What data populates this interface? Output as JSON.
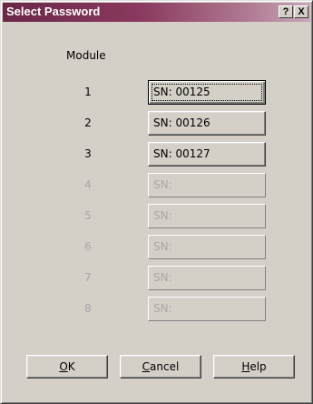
{
  "window": {
    "title": "Select Password",
    "help_glyph": "?",
    "close_glyph": "X"
  },
  "column_header": "Module",
  "modules": [
    {
      "number": "1",
      "serial": "SN: 00125",
      "enabled": true,
      "focused": true
    },
    {
      "number": "2",
      "serial": "SN: 00126",
      "enabled": true,
      "focused": false
    },
    {
      "number": "3",
      "serial": "SN: 00127",
      "enabled": true,
      "focused": false
    },
    {
      "number": "4",
      "serial": "SN:",
      "enabled": false,
      "focused": false
    },
    {
      "number": "5",
      "serial": "SN:",
      "enabled": false,
      "focused": false
    },
    {
      "number": "6",
      "serial": "SN:",
      "enabled": false,
      "focused": false
    },
    {
      "number": "7",
      "serial": "SN:",
      "enabled": false,
      "focused": false
    },
    {
      "number": "8",
      "serial": "SN:",
      "enabled": false,
      "focused": false
    }
  ],
  "buttons": {
    "ok": {
      "mnemonic": "O",
      "rest": "K"
    },
    "cancel": {
      "mnemonic": "C",
      "rest": "ancel"
    },
    "help": {
      "mnemonic": "H",
      "rest": "elp"
    }
  },
  "colors": {
    "titlebar_start": "#6b2748",
    "titlebar_end": "#c9a7b7",
    "dialog_face": "#d4d0c8",
    "disabled_text": "#a8a8a8"
  }
}
